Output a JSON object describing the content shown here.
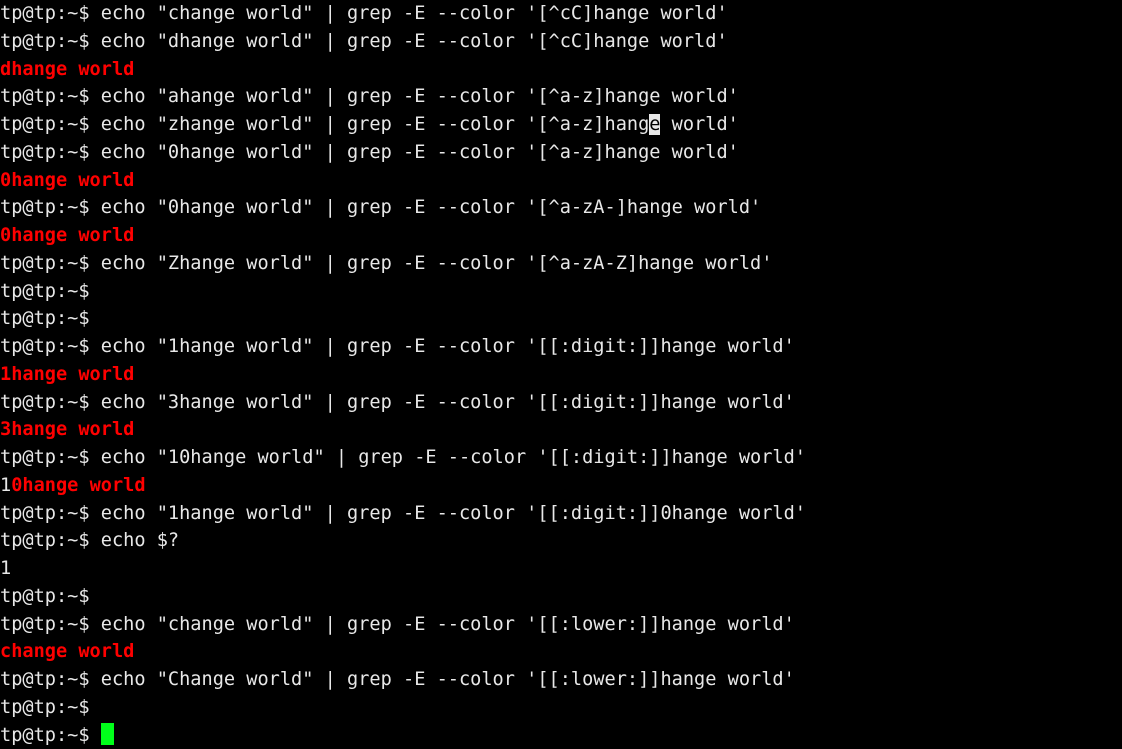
{
  "terminal": {
    "title": "tp@tp terminal",
    "prompt": "tp@tp:~$ ",
    "colors": {
      "background": "#000000",
      "foreground": "#e8e8e8",
      "match_highlight": "#ff0000",
      "cursor": "#00ff1a",
      "cursor_inverse_bg": "#e8e8e8"
    },
    "cursor": {
      "style": "block",
      "position_line": 26,
      "inverse_cursor_line": 4,
      "inverse_cursor_char": "e"
    },
    "lines": [
      {
        "index": 0,
        "type": "command",
        "segments": [
          {
            "text": "tp@tp:~$ echo \"change world\" | grep -E --color '[^cC]hange world'",
            "color": "default"
          }
        ]
      },
      {
        "index": 1,
        "type": "command",
        "segments": [
          {
            "text": "tp@tp:~$ echo \"dhange world\" | grep -E --color '[^cC]hange world'",
            "color": "default"
          }
        ]
      },
      {
        "index": 2,
        "type": "output",
        "segments": [
          {
            "text": "dhange world",
            "color": "red"
          }
        ]
      },
      {
        "index": 3,
        "type": "command",
        "segments": [
          {
            "text": "tp@tp:~$ echo \"ahange world\" | grep -E --color '[^a-z]hange world'",
            "color": "default"
          }
        ]
      },
      {
        "index": 4,
        "type": "command",
        "segments": [
          {
            "text": "tp@tp:~$ echo \"zhange world\" | grep -E --color '[^a-z]hang",
            "color": "default"
          },
          {
            "text": "e",
            "color": "inverse"
          },
          {
            "text": " world'",
            "color": "default"
          }
        ]
      },
      {
        "index": 5,
        "type": "command",
        "segments": [
          {
            "text": "tp@tp:~$ echo \"0hange world\" | grep -E --color '[^a-z]hange world'",
            "color": "default"
          }
        ]
      },
      {
        "index": 6,
        "type": "output",
        "segments": [
          {
            "text": "0hange world",
            "color": "red"
          }
        ]
      },
      {
        "index": 7,
        "type": "command",
        "segments": [
          {
            "text": "tp@tp:~$ echo \"0hange world\" | grep -E --color '[^a-zA-]hange world'",
            "color": "default"
          }
        ]
      },
      {
        "index": 8,
        "type": "output",
        "segments": [
          {
            "text": "0hange world",
            "color": "red"
          }
        ]
      },
      {
        "index": 9,
        "type": "command",
        "segments": [
          {
            "text": "tp@tp:~$ echo \"Zhange world\" | grep -E --color '[^a-zA-Z]hange world'",
            "color": "default"
          }
        ]
      },
      {
        "index": 10,
        "type": "prompt",
        "segments": [
          {
            "text": "tp@tp:~$ ",
            "color": "default"
          }
        ]
      },
      {
        "index": 11,
        "type": "prompt",
        "segments": [
          {
            "text": "tp@tp:~$ ",
            "color": "default"
          }
        ]
      },
      {
        "index": 12,
        "type": "command",
        "segments": [
          {
            "text": "tp@tp:~$ echo \"1hange world\" | grep -E --color '[[:digit:]]hange world'",
            "color": "default"
          }
        ]
      },
      {
        "index": 13,
        "type": "output",
        "segments": [
          {
            "text": "1hange world",
            "color": "red"
          }
        ]
      },
      {
        "index": 14,
        "type": "command",
        "segments": [
          {
            "text": "tp@tp:~$ echo \"3hange world\" | grep -E --color '[[:digit:]]hange world'",
            "color": "default"
          }
        ]
      },
      {
        "index": 15,
        "type": "output",
        "segments": [
          {
            "text": "3hange world",
            "color": "red"
          }
        ]
      },
      {
        "index": 16,
        "type": "command",
        "segments": [
          {
            "text": "tp@tp:~$ echo \"10hange world\" | grep -E --color '[[:digit:]]hange world'",
            "color": "default"
          }
        ]
      },
      {
        "index": 17,
        "type": "output",
        "segments": [
          {
            "text": "1",
            "color": "default"
          },
          {
            "text": "0hange world",
            "color": "red"
          }
        ]
      },
      {
        "index": 18,
        "type": "command",
        "segments": [
          {
            "text": "tp@tp:~$ echo \"1hange world\" | grep -E --color '[[:digit:]]0hange world'",
            "color": "default"
          }
        ]
      },
      {
        "index": 19,
        "type": "command",
        "segments": [
          {
            "text": "tp@tp:~$ echo $?",
            "color": "default"
          }
        ]
      },
      {
        "index": 20,
        "type": "output",
        "segments": [
          {
            "text": "1",
            "color": "default"
          }
        ]
      },
      {
        "index": 21,
        "type": "prompt",
        "segments": [
          {
            "text": "tp@tp:~$ ",
            "color": "default"
          }
        ]
      },
      {
        "index": 22,
        "type": "command",
        "segments": [
          {
            "text": "tp@tp:~$ echo \"change world\" | grep -E --color '[[:lower:]]hange world'",
            "color": "default"
          }
        ]
      },
      {
        "index": 23,
        "type": "output",
        "segments": [
          {
            "text": "change world",
            "color": "red"
          }
        ]
      },
      {
        "index": 24,
        "type": "command",
        "segments": [
          {
            "text": "tp@tp:~$ echo \"Change world\" | grep -E --color '[[:lower:]]hange world'",
            "color": "default"
          }
        ]
      },
      {
        "index": 25,
        "type": "prompt",
        "segments": [
          {
            "text": "tp@tp:~$ ",
            "color": "default"
          }
        ]
      },
      {
        "index": 26,
        "type": "prompt-with-cursor",
        "segments": [
          {
            "text": "tp@tp:~$ ",
            "color": "default"
          },
          {
            "text": " ",
            "color": "cursor"
          }
        ]
      }
    ]
  }
}
